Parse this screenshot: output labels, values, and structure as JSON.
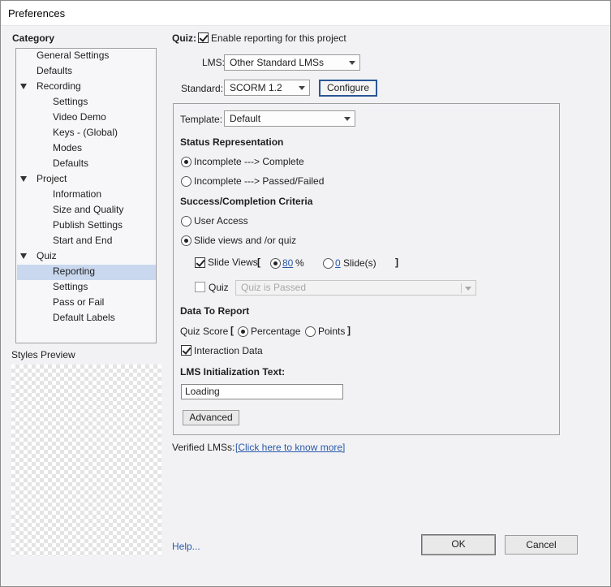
{
  "window": {
    "title": "Preferences"
  },
  "category": {
    "title": "Category",
    "items": [
      {
        "label": "General Settings"
      },
      {
        "label": "Defaults"
      },
      {
        "label": "Recording"
      },
      {
        "label": "Settings"
      },
      {
        "label": "Video Demo"
      },
      {
        "label": "Keys - (Global)"
      },
      {
        "label": "Modes"
      },
      {
        "label": "Defaults"
      },
      {
        "label": "Project"
      },
      {
        "label": "Information"
      },
      {
        "label": "Size and Quality"
      },
      {
        "label": "Publish Settings"
      },
      {
        "label": "Start and End"
      },
      {
        "label": "Quiz"
      },
      {
        "label": "Reporting"
      },
      {
        "label": "Settings"
      },
      {
        "label": "Pass or Fail"
      },
      {
        "label": "Default Labels"
      }
    ],
    "selected": "Reporting"
  },
  "styles_preview": {
    "title": "Styles Preview"
  },
  "quiz": {
    "label": "Quiz:",
    "enable_reporting": {
      "label": "Enable reporting for this project",
      "checked": true
    },
    "lms": {
      "label": "LMS:",
      "value": "Other Standard LMSs"
    },
    "standard": {
      "label": "Standard:",
      "value": "SCORM 1.2"
    },
    "configure_label": "Configure"
  },
  "group": {
    "template": {
      "label": "Template:",
      "value": "Default"
    },
    "status_representation": {
      "title": "Status Representation",
      "options": [
        {
          "label": "Incomplete ---> Complete",
          "selected": true
        },
        {
          "label": "Incomplete ---> Passed/Failed",
          "selected": false
        }
      ]
    },
    "success_criteria": {
      "title": "Success/Completion Criteria",
      "options": [
        {
          "label": "User Access",
          "selected": false
        },
        {
          "label": "Slide views and /or quiz",
          "selected": true
        }
      ],
      "slide_views": {
        "label": "Slide Views",
        "checked": true,
        "open_bracket": "[",
        "close_bracket": "]",
        "percent_value": "80",
        "percent_unit": "%",
        "percent_selected": true,
        "slides_value": "0",
        "slides_unit": "Slide(s)",
        "slides_selected": false
      },
      "quiz": {
        "label": "Quiz",
        "checked": false,
        "dropdown_value": "Quiz is Passed"
      }
    },
    "data_to_report": {
      "title": "Data To Report",
      "quiz_score": {
        "label": "Quiz Score",
        "open_bracket": "[",
        "close_bracket": "]",
        "options": [
          {
            "label": "Percentage",
            "selected": true
          },
          {
            "label": "Points",
            "selected": false
          }
        ]
      },
      "interaction_data": {
        "label": "Interaction Data",
        "checked": true
      }
    },
    "lms_init": {
      "title": "LMS Initialization Text:",
      "value": "Loading"
    },
    "advanced_label": "Advanced"
  },
  "verified": {
    "label": "Verified LMSs:",
    "link": "[Click here to know more]"
  },
  "footer": {
    "help": "Help...",
    "ok": "OK",
    "cancel": "Cancel"
  },
  "colors": {
    "accent": "#2b5694",
    "link": "#2a5aa8",
    "selection": "#c9d8ef"
  }
}
